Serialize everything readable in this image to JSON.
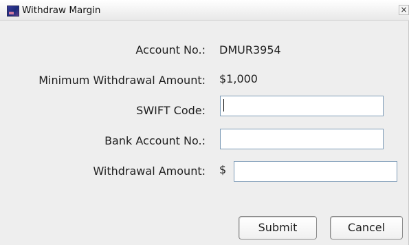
{
  "window": {
    "title": "Withdraw Margin",
    "close_glyph": "×",
    "app_icon": "app-icon",
    "close_icon": "close-icon"
  },
  "form": {
    "account_no": {
      "label": "Account No.:",
      "value": "DMUR3954"
    },
    "minimum_withdrawal": {
      "label": "Minimum Withdrawal Amount:",
      "value": "$1,000"
    },
    "swift_code": {
      "label": "SWIFT Code:",
      "value": ""
    },
    "bank_account_no": {
      "label": "Bank Account No.:",
      "value": ""
    },
    "withdrawal_amount": {
      "label": "Withdrawal Amount:",
      "currency": "$",
      "value": ""
    }
  },
  "buttons": {
    "submit": "Submit",
    "cancel": "Cancel"
  },
  "colors": {
    "background": "#eeeeee",
    "field_border": "#7c9ab6",
    "text": "#1e1e1e"
  }
}
